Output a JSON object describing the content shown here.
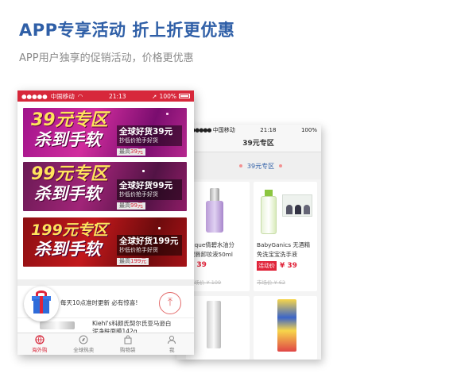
{
  "header": {
    "title": "APP专享活动 折上折更优惠",
    "subtitle": "APP用户独享的促销活动，价格更优惠"
  },
  "front_phone": {
    "status": {
      "carrier": "中国移动",
      "time": "21:13",
      "battery": "100%"
    },
    "banners": [
      {
        "big": "39元专区",
        "slogan": "杀到手软",
        "title": "全球好货39元",
        "sub": "抄低价抢手好货",
        "low_prefix": "最高",
        "low_value": "39元"
      },
      {
        "big": "99元专区",
        "slogan": "杀到手软",
        "title": "全球好货99元",
        "sub": "抄低价抢手好货",
        "low_prefix": "最高",
        "low_value": "99元"
      },
      {
        "big": "199元专区",
        "slogan": "杀到手软",
        "title": "全球好货199元",
        "sub": "抄低价抢手好货",
        "low_prefix": "最高",
        "low_value": "199元"
      }
    ],
    "notice": "每天10点准时更新 必有惊喜!",
    "product_name": "Kiehl's科颜氏契尔氏亚马逊白",
    "product_name2": "泥净肤面膜142g",
    "tabs": [
      "海外购",
      "全球热卖",
      "购物袋",
      "我"
    ]
  },
  "back_phone": {
    "status": {
      "carrier": "中国移动",
      "time": "21:18",
      "battery": "100%"
    },
    "nav_title": "39元专区",
    "section_label": "39元专区",
    "products": [
      {
        "name1": "nique倩碧水油分",
        "name2": "眼唇卸妆液50ml",
        "tag": "",
        "price": "¥ 39",
        "orig": "市场价 ¥ 109"
      },
      {
        "name1": "BabyGanics 无酒精",
        "name2": "免洗宝宝洗手液",
        "tag": "活动价",
        "price": "¥ 39",
        "orig": "市场价 ¥ 62"
      }
    ]
  },
  "colors": {
    "accent": "#d7283b",
    "title_blue": "#2f5fa7"
  }
}
